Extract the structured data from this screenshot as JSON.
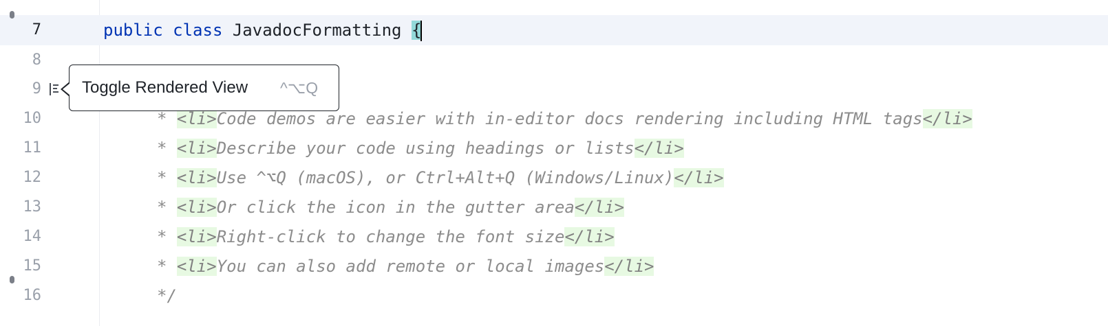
{
  "editor": {
    "lines": [
      {
        "number": "7",
        "segments": [
          {
            "t": "public",
            "c": "kw"
          },
          {
            "t": " ",
            "c": ""
          },
          {
            "t": "class",
            "c": "kw"
          },
          {
            "t": " JavadocFormatting ",
            "c": ""
          },
          {
            "t": "{",
            "c": "brace-hl"
          }
        ]
      },
      {
        "number": "8",
        "segments": []
      },
      {
        "number": "9",
        "segments": []
      },
      {
        "number": "10",
        "segments": [
          {
            "t": "* ",
            "c": ""
          },
          {
            "t": "<li>",
            "c": "tag"
          },
          {
            "t": "Code demos are easier with in-editor docs rendering including HTML tags",
            "c": ""
          },
          {
            "t": "</li>",
            "c": "tag"
          }
        ]
      },
      {
        "number": "11",
        "segments": [
          {
            "t": "* ",
            "c": ""
          },
          {
            "t": "<li>",
            "c": "tag"
          },
          {
            "t": "Describe your code using headings or lists",
            "c": ""
          },
          {
            "t": "</li>",
            "c": "tag"
          }
        ]
      },
      {
        "number": "12",
        "segments": [
          {
            "t": "* ",
            "c": ""
          },
          {
            "t": "<li>",
            "c": "tag"
          },
          {
            "t": "Use ^⌥Q (macOS), or Ctrl+Alt+Q (Windows/Linux)",
            "c": ""
          },
          {
            "t": "</li>",
            "c": "tag"
          }
        ]
      },
      {
        "number": "13",
        "segments": [
          {
            "t": "* ",
            "c": ""
          },
          {
            "t": "<li>",
            "c": "tag"
          },
          {
            "t": "Or click the icon in the gutter area",
            "c": ""
          },
          {
            "t": "</li>",
            "c": "tag"
          }
        ]
      },
      {
        "number": "14",
        "segments": [
          {
            "t": "* ",
            "c": ""
          },
          {
            "t": "<li>",
            "c": "tag"
          },
          {
            "t": "Right-click to change the font size",
            "c": ""
          },
          {
            "t": "</li>",
            "c": "tag"
          }
        ]
      },
      {
        "number": "15",
        "segments": [
          {
            "t": "* ",
            "c": ""
          },
          {
            "t": "<li>",
            "c": "tag"
          },
          {
            "t": "You can also add remote or local images",
            "c": ""
          },
          {
            "t": "</li>",
            "c": "tag"
          }
        ]
      },
      {
        "number": "16",
        "segments": [
          {
            "t": "*/",
            "c": ""
          }
        ]
      }
    ],
    "current_line": "7"
  },
  "tooltip": {
    "label": "Toggle Rendered View",
    "shortcut": "^⌥Q",
    "icon": "render-doc-icon"
  },
  "colors": {
    "keyword": "#0033b3",
    "brace_highlight": "#93d9d9",
    "tag_background": "#e7f9e2",
    "current_line": "#f1f4fa",
    "doc_comment": "#8c8c8c"
  }
}
